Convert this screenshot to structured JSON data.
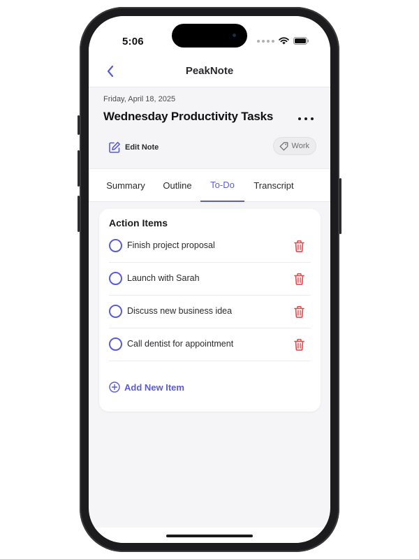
{
  "status_bar": {
    "time": "5:06"
  },
  "nav": {
    "title": "PeakNote"
  },
  "note": {
    "date": "Friday, April 18, 2025",
    "title": "Wednesday Productivity Tasks",
    "edit_label": "Edit Note",
    "tag": "Work"
  },
  "tabs": [
    {
      "label": "Summary",
      "active": false
    },
    {
      "label": "Outline",
      "active": false
    },
    {
      "label": "To-Do",
      "active": true
    },
    {
      "label": "Transcript",
      "active": false
    }
  ],
  "action_items": {
    "title": "Action Items",
    "items": [
      {
        "text": "Finish project proposal",
        "done": false
      },
      {
        "text": "Launch with Sarah",
        "done": false
      },
      {
        "text": "Discuss new business idea",
        "done": false
      },
      {
        "text": "Call dentist for appointment",
        "done": false
      }
    ],
    "add_label": "Add New Item"
  },
  "colors": {
    "accent": "#5b5bd6",
    "delete": "#e5484d",
    "background": "#f5f5f7"
  },
  "icons": {
    "back": "chevron-left-icon",
    "more": "ellipsis-icon",
    "edit": "edit-note-icon",
    "tag": "tag-icon",
    "delete": "trash-icon",
    "add": "plus-circle-icon"
  }
}
